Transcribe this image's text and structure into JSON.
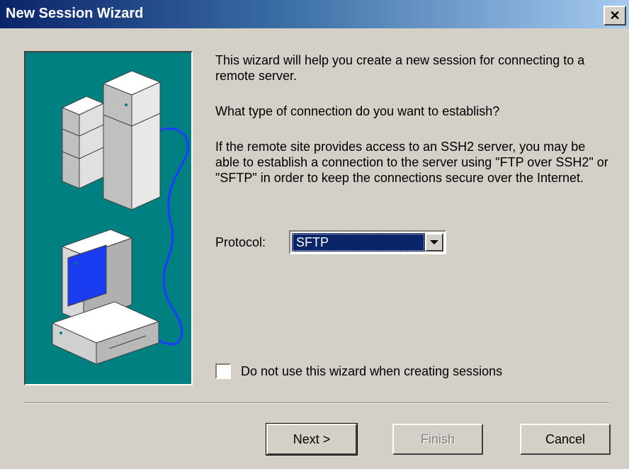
{
  "window": {
    "title": "New Session Wizard",
    "close_label": "✕"
  },
  "intro": {
    "paragraph1": "This wizard will help you create a new session for connecting to a remote server.",
    "paragraph2": "What type of connection do you want to establish?",
    "paragraph3": "If the remote site provides access to an SSH2 server, you may be able to establish a connection to the server using \"FTP over SSH2\" or \"SFTP\" in order to keep the connections secure over the Internet."
  },
  "protocol": {
    "label": "Protocol:",
    "selected": "SFTP"
  },
  "checkbox": {
    "label": "Do not use this wizard when creating sessions",
    "checked": false
  },
  "buttons": {
    "next": "Next >",
    "finish": "Finish",
    "cancel": "Cancel"
  },
  "colors": {
    "panel_bg": "#008080",
    "title_gradient_start": "#0a246a",
    "selection_bg": "#0a246a",
    "cable": "#1e3cff",
    "monitor_screen": "#1a3cf0"
  },
  "illustration": {
    "icons": [
      "server-tower-icon",
      "computer-icon",
      "network-cable-icon"
    ]
  }
}
